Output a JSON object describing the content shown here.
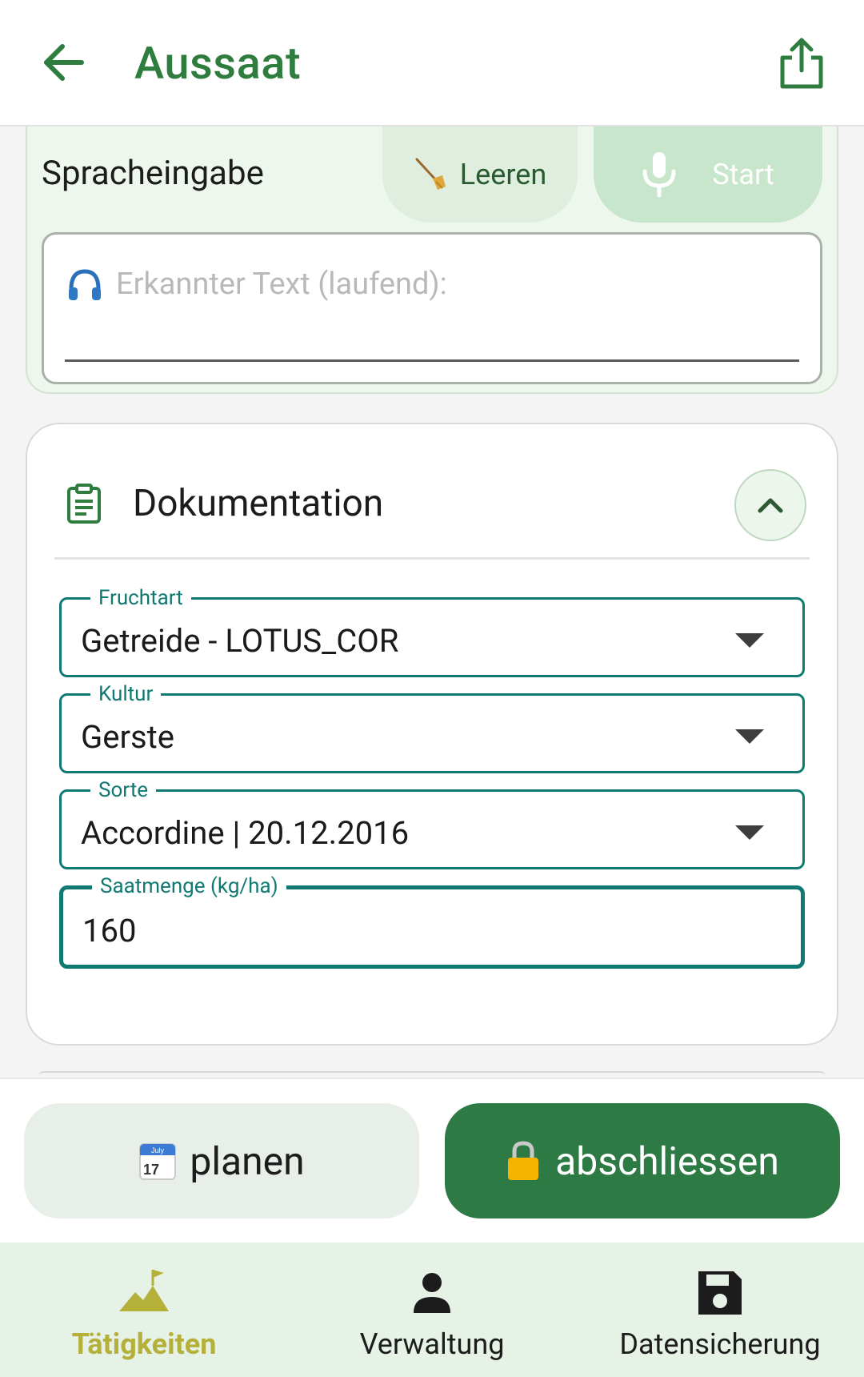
{
  "appbar": {
    "title": "Aussaat",
    "back_icon": "arrow-left-icon",
    "share_icon": "share-icon"
  },
  "speech": {
    "title": "Spracheingabe",
    "clear_label": "Leeren",
    "start_label": "Start",
    "placeholder": "Erkannter Text (laufend):"
  },
  "documentation": {
    "title": "Dokumentation",
    "fields": {
      "fruchtart": {
        "label": "Fruchtart",
        "value": "Getreide - LOTUS_COR"
      },
      "kultur": {
        "label": "Kultur",
        "value": "Gerste"
      },
      "sorte": {
        "label": "Sorte",
        "value": "Accordine | 20.12.2016"
      },
      "saatmenge": {
        "label": "Saatmenge (kg/ha)",
        "value": "160"
      }
    }
  },
  "actions": {
    "plan_label": "planen",
    "finish_label": "abschliessen"
  },
  "nav": {
    "items": [
      {
        "label": "Tätigkeiten",
        "active": true
      },
      {
        "label": "Verwaltung",
        "active": false
      },
      {
        "label": "Datensicherung",
        "active": false
      }
    ]
  },
  "colors": {
    "primary": "#2e7d3e",
    "accent_teal": "#107a72",
    "active_nav": "#b5b03a"
  }
}
